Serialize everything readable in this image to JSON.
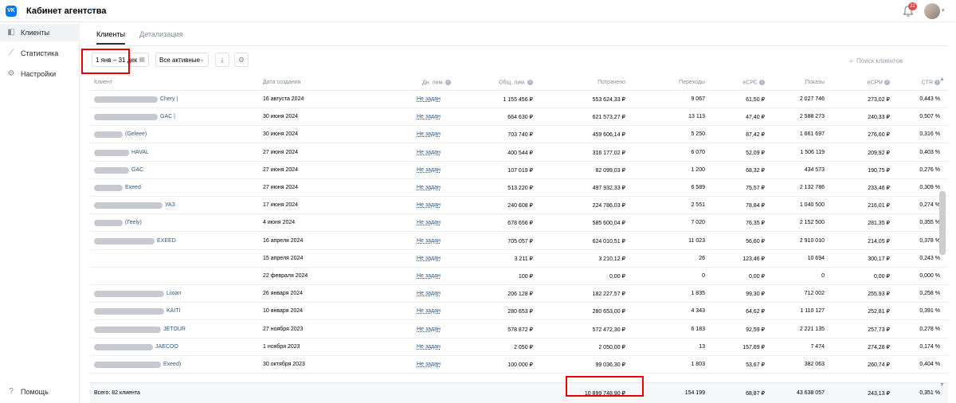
{
  "app": {
    "logo": "VK",
    "title": "Кабинет агентства"
  },
  "header": {
    "notifications_count": "22"
  },
  "sidebar": {
    "items": [
      {
        "label": "Клиенты",
        "icon": "megaphone-icon",
        "active": true
      },
      {
        "label": "Статистика",
        "icon": "chart-icon",
        "active": false
      },
      {
        "label": "Настройки",
        "icon": "gear-icon",
        "active": false
      }
    ],
    "help_label": "Помощь"
  },
  "tabs": [
    {
      "label": "Клиенты",
      "active": true
    },
    {
      "label": "Детализация",
      "active": false
    }
  ],
  "toolbar": {
    "period": "1 янв – 31 дек",
    "ads_filter": "Все активные",
    "search_placeholder": "Поиск клиентов"
  },
  "table": {
    "columns": [
      "Клиент",
      "Дата создания",
      "Дн. лим.",
      "Общ. лим.",
      "Потрачено",
      "Переходы",
      "eCPC",
      "Показы",
      "eCPM",
      "CTR"
    ],
    "rows": [
      {
        "client": "Chery |",
        "date": "16 августа 2024",
        "dlim": "Не задан",
        "olim": "1 155 456 ₽",
        "spent": "553 624,33 ₽",
        "clicks": "9 067",
        "ecpc": "61,50 ₽",
        "shows": "2 027 746",
        "ecpm": "273,02 ₽",
        "ctr": "0,443 %"
      },
      {
        "client": "GAC |",
        "date": "30 июня 2024",
        "dlim": "Не задан",
        "olim": "664 630 ₽",
        "spent": "621 573,27 ₽",
        "clicks": "13 113",
        "ecpc": "47,40 ₽",
        "shows": "2 588 273",
        "ecpm": "240,33 ₽",
        "ctr": "0,507 %"
      },
      {
        "client": "(Geleee)",
        "date": "30 июня 2024",
        "dlim": "Не задан",
        "olim": "703 740 ₽",
        "spent": "459 606,14 ₽",
        "clicks": "5 250",
        "ecpc": "87,42 ₽",
        "shows": "1 661 697",
        "ecpm": "276,60 ₽",
        "ctr": "0,316 %"
      },
      {
        "client": "HAVAL",
        "date": "27 июня 2024",
        "dlim": "Не задан",
        "olim": "400 544 ₽",
        "spent": "316 177,02 ₽",
        "clicks": "6 070",
        "ecpc": "52,09 ₽",
        "shows": "1 506 119",
        "ecpm": "209,92 ₽",
        "ctr": "0,403 %"
      },
      {
        "client": "GAC",
        "date": "27 июня 2024",
        "dlim": "Не задан",
        "olim": "107 019 ₽",
        "spent": "82 099,03 ₽",
        "clicks": "1 200",
        "ecpc": "68,32 ₽",
        "shows": "434 573",
        "ecpm": "190,75 ₽",
        "ctr": "0,276 %"
      },
      {
        "client": "Exeed",
        "date": "27 июня 2024",
        "dlim": "Не задан",
        "olim": "513 220 ₽",
        "spent": "497 932,33 ₽",
        "clicks": "6 589",
        "ecpc": "75,57 ₽",
        "shows": "2 132 786",
        "ecpm": "233,46 ₽",
        "ctr": "0,309 %"
      },
      {
        "client": "УАЗ",
        "date": "17 июня 2024",
        "dlim": "Не задан",
        "olim": "240 608 ₽",
        "spent": "224 786,03 ₽",
        "clicks": "2 551",
        "ecpc": "78,84 ₽",
        "shows": "1 040 500",
        "ecpm": "216,01 ₽",
        "ctr": "0,274 %"
      },
      {
        "client": "(Геely)",
        "date": "4 июня 2024",
        "dlim": "Не задан",
        "olim": "678 656 ₽",
        "spent": "585 600,04 ₽",
        "clicks": "7 020",
        "ecpc": "76,35 ₽",
        "shows": "2 152 500",
        "ecpm": "281,35 ₽",
        "ctr": "0,355 %"
      },
      {
        "client": "EXEED",
        "date": "16 апреля 2024",
        "dlim": "Не задан",
        "olim": "705 057 ₽",
        "spent": "624 010,51 ₽",
        "clicks": "11 023",
        "ecpc": "56,60 ₽",
        "shows": "2 910 010",
        "ecpm": "214,05 ₽",
        "ctr": "0,378 %"
      },
      {
        "client": "",
        "date": "15 апреля 2024",
        "dlim": "Не задан",
        "olim": "3 211 ₽",
        "spent": "3 210,12 ₽",
        "clicks": "26",
        "ecpc": "123,46 ₽",
        "shows": "10 694",
        "ecpm": "300,17 ₽",
        "ctr": "0,243 %"
      },
      {
        "client": "",
        "date": "22 февраля 2024",
        "dlim": "Не задан",
        "olim": "100 ₽",
        "spent": "0,00 ₽",
        "clicks": "0",
        "ecpc": "0,00 ₽",
        "shows": "0",
        "ecpm": "0,00 ₽",
        "ctr": "0,000 %"
      },
      {
        "client": "Lixian",
        "date": "26 января 2024",
        "dlim": "Не задан",
        "olim": "206 128 ₽",
        "spent": "182 227,57 ₽",
        "clicks": "1 835",
        "ecpc": "99,30 ₽",
        "shows": "712 002",
        "ecpm": "255,93 ₽",
        "ctr": "0,258 %"
      },
      {
        "client": "KAITI",
        "date": "10 января 2024",
        "dlim": "Не задан",
        "olim": "280 653 ₽",
        "spent": "280 653,00 ₽",
        "clicks": "4 343",
        "ecpc": "64,62 ₽",
        "shows": "1 110 127",
        "ecpm": "252,81 ₽",
        "ctr": "0,391 %"
      },
      {
        "client": "JETOUR",
        "date": "27 ноября 2023",
        "dlim": "Не задан",
        "olim": "578 872 ₽",
        "spent": "572 472,30 ₽",
        "clicks": "6 183",
        "ecpc": "92,59 ₽",
        "shows": "2 221 135",
        "ecpm": "257,73 ₽",
        "ctr": "0,278 %"
      },
      {
        "client": "JAECOO",
        "date": "1 ноября 2023",
        "dlim": "Не задан",
        "olim": "2 050 ₽",
        "spent": "2 050,00 ₽",
        "clicks": "13",
        "ecpc": "157,69 ₽",
        "shows": "7 474",
        "ecpm": "274,28 ₽",
        "ctr": "0,174 %"
      },
      {
        "client": "Exeed)",
        "date": "30 октября 2023",
        "dlim": "Не задан",
        "olim": "100 000 ₽",
        "spent": "99 036,30 ₽",
        "clicks": "1 803",
        "ecpc": "53,67 ₽",
        "shows": "382 063",
        "ecpm": "260,74 ₽",
        "ctr": "0,404 %"
      }
    ],
    "footer": {
      "label": "Всего: 82 клиента",
      "spent": "10 899 748,90 ₽",
      "clicks": "154 199",
      "ecpc": "68,87 ₽",
      "shows": "43 638 057",
      "ecpm": "243,13 ₽",
      "ctr": "0,351 %"
    }
  }
}
